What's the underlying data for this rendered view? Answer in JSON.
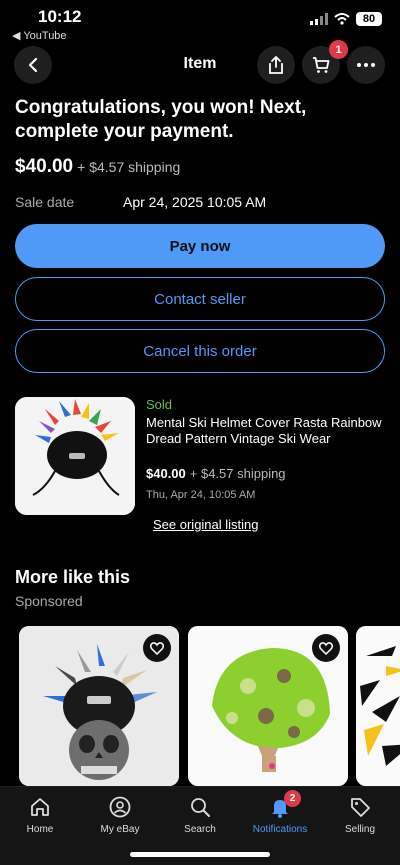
{
  "status_bar": {
    "time": "10:12",
    "back_app": "◀ YouTube",
    "battery": "80"
  },
  "nav": {
    "title": "Item",
    "cart_count": "1"
  },
  "order": {
    "headline": "Congratulations, you won! Next, complete your payment.",
    "price": "$40.00",
    "shipping": "+ $4.57 shipping",
    "sale_date_label": "Sale date",
    "sale_date_value": "Apr 24, 2025 10:05 AM"
  },
  "actions": {
    "pay_now": "Pay now",
    "contact_seller": "Contact seller",
    "cancel_order": "Cancel this order"
  },
  "item": {
    "status": "Sold",
    "title": "Mental Ski Helmet Cover Rasta Rainbow Dread Pattern Vintage Ski Wear",
    "price": "$40.00",
    "shipping": "+ $4.57 shipping",
    "date": "Thu, Apr 24, 10:05 AM",
    "see_listing": "See original listing"
  },
  "more": {
    "title": "More like this",
    "sponsored": "Sponsored"
  },
  "tabs": [
    {
      "label": "Home",
      "icon": "home-icon"
    },
    {
      "label": "My eBay",
      "icon": "profile-icon"
    },
    {
      "label": "Search",
      "icon": "search-icon"
    },
    {
      "label": "Notifications",
      "icon": "bell-icon",
      "badge": "2",
      "active": true
    },
    {
      "label": "Selling",
      "icon": "tag-icon"
    }
  ],
  "colors": {
    "accent": "#4f9af7",
    "sold": "#5fbf4f",
    "badge": "#e0394e",
    "background": "#000000"
  }
}
